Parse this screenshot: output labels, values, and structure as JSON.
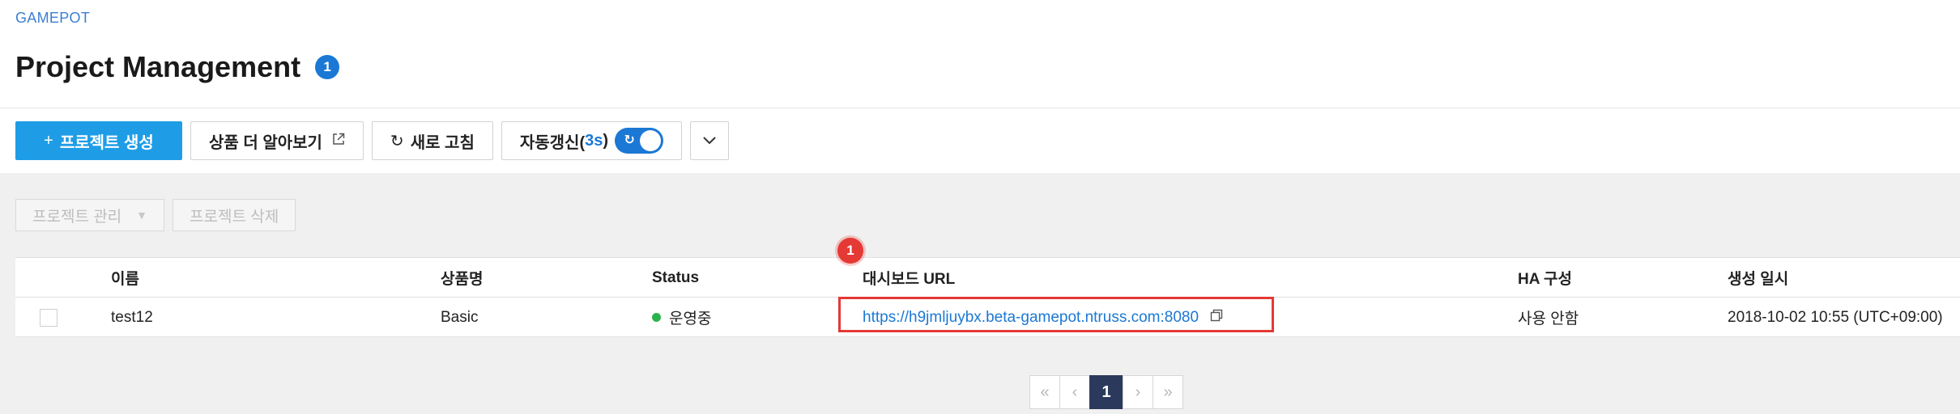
{
  "breadcrumb": "GAMEPOT",
  "page": {
    "title": "Project Management",
    "info_badge": "1"
  },
  "toolbar": {
    "create_icon": "+",
    "create_label": "프로젝트 생성",
    "learn_more_label": "상품 더 알아보기",
    "learn_more_icon": "external-link-icon",
    "refresh_icon": "↻",
    "refresh_label": "새로 고침",
    "auto_refresh_label": "자동갱신(",
    "auto_refresh_interval": "3s",
    "auto_refresh_close": ")",
    "auto_refresh_on": true,
    "more_icon": "chevron-down-icon"
  },
  "sub_toolbar": {
    "manage_label": "프로젝트 관리",
    "delete_label": "프로젝트 삭제"
  },
  "table": {
    "columns": [
      "이름",
      "상품명",
      "Status",
      "대시보드 URL",
      "HA 구성",
      "생성 일시"
    ],
    "rows": [
      {
        "name": "test12",
        "product": "Basic",
        "status": "운영중",
        "dashboard_url": "https://h9jmljuybx.beta-gamepot.ntruss.com:8080",
        "ha": "사용 안함",
        "created": "2018-10-02 10:55 (UTC+09:00)"
      }
    ]
  },
  "callout": {
    "number": "1"
  },
  "pagination": {
    "current_page": "1",
    "first_icon": "«",
    "prev_icon": "‹",
    "next_icon": "›",
    "last_icon": "»"
  },
  "colors": {
    "primary": "#1e9de6",
    "accent": "#1b78d4",
    "status_running": "#2bb24c",
    "highlight": "#e53935",
    "pagination_active": "#2b3a5c"
  }
}
